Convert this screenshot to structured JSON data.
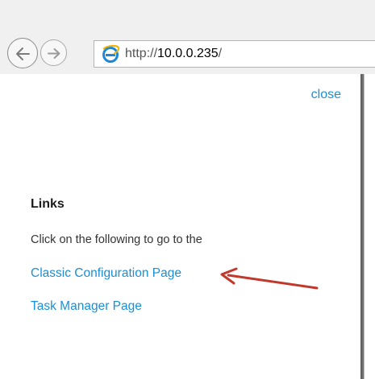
{
  "browser": {
    "address": {
      "scheme": "http://",
      "host": "10.0.0.235",
      "path": "/"
    },
    "icons": {
      "back": "back-arrow-icon",
      "forward": "forward-arrow-icon",
      "page": "internet-explorer-icon"
    }
  },
  "page": {
    "close_label": "close",
    "heading": "Links",
    "intro": "Click on the following to go to the",
    "links": [
      {
        "label": "Classic Configuration Page"
      },
      {
        "label": "Task Manager Page"
      }
    ]
  },
  "annotation": {
    "arrow_color": "#c0392b"
  },
  "colors": {
    "link": "#1a8fd6",
    "toolbar": "#f0f0f0"
  }
}
